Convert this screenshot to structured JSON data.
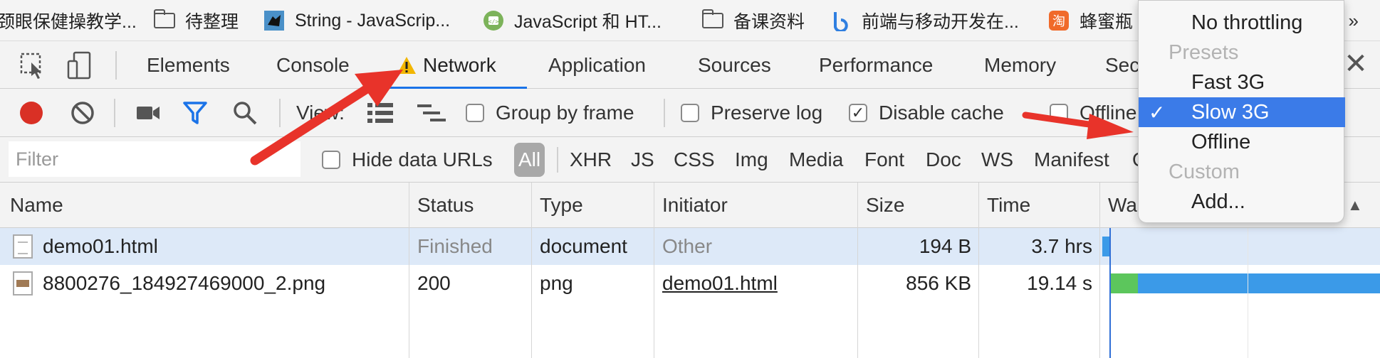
{
  "bookmarks": [
    {
      "label": "颈眼保健操教学...",
      "icon": "page-icon"
    },
    {
      "label": "待整理",
      "icon": "folder-icon"
    },
    {
      "label": "String - JavaScrip...",
      "icon": "mdn-icon"
    },
    {
      "label": "JavaScript 和 HT...",
      "icon": "code-icon"
    },
    {
      "label": "备课资料",
      "icon": "folder-icon"
    },
    {
      "label": "前端与移动开发在...",
      "icon": "bilibili-icon"
    },
    {
      "label": "蜂蜜瓶",
      "icon": "taobao-icon"
    }
  ],
  "bookmarks_overflow": "»",
  "devtools": {
    "tabs": [
      "Elements",
      "Console",
      "Network",
      "Application",
      "Sources",
      "Performance",
      "Memory",
      "Sec"
    ],
    "active_tab": "Network",
    "close": "✕"
  },
  "toolbar": {
    "view_label": "View:",
    "group_by_frame": {
      "label": "Group by frame",
      "checked": false
    },
    "preserve_log": {
      "label": "Preserve log",
      "checked": false
    },
    "disable_cache": {
      "label": "Disable cache",
      "checked": true,
      "mark": "✓"
    },
    "offline": {
      "label": "Offline",
      "checked": false
    },
    "record_color": "#d93025",
    "filter_color": "#1a73e8"
  },
  "filterbar": {
    "placeholder": "Filter",
    "hide_data_urls": "Hide data URLs",
    "types": [
      "All",
      "XHR",
      "JS",
      "CSS",
      "Img",
      "Media",
      "Font",
      "Doc",
      "WS",
      "Manifest",
      "O"
    ]
  },
  "table": {
    "columns": [
      "Name",
      "Status",
      "Type",
      "Initiator",
      "Size",
      "Time",
      "Wa"
    ],
    "rows": [
      {
        "name": "demo01.html",
        "status": "Finished",
        "type": "document",
        "initiator": "Other",
        "size": "194 B",
        "time": "3.7 hrs"
      },
      {
        "name": "8800276_184927469000_2.png",
        "status": "200",
        "type": "png",
        "initiator": "demo01.html",
        "size": "856 KB",
        "time": "19.14 s"
      }
    ],
    "sort_indicator": "▲"
  },
  "throttle_menu": {
    "items": [
      {
        "label": "No throttling",
        "kind": "option"
      },
      {
        "label": "Presets",
        "kind": "header"
      },
      {
        "label": "Fast 3G",
        "kind": "option"
      },
      {
        "label": "Slow 3G",
        "kind": "option",
        "selected": true,
        "check": "✓"
      },
      {
        "label": "Offline",
        "kind": "option"
      },
      {
        "label": "Custom",
        "kind": "header"
      },
      {
        "label": "Add...",
        "kind": "option"
      }
    ]
  },
  "colors": {
    "annotation_arrow": "#e8332a",
    "waterfall_blue": "#3b9ae8",
    "waterfall_green": "#5cc65c",
    "highlight": "#3b7be8",
    "warning": "#f2b600"
  }
}
